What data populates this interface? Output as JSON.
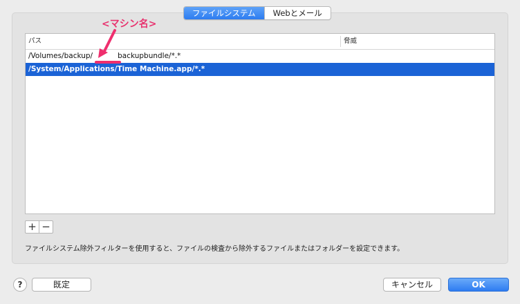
{
  "tabs": [
    {
      "label": "ファイルシステム",
      "selected": true
    },
    {
      "label": "Webとメール",
      "selected": false
    }
  ],
  "table": {
    "columns": {
      "path": "パス",
      "threat": "脅威"
    },
    "rows": [
      {
        "path_prefix": "/Volumes/backup/",
        "path_suffix": "backupbundle/*.*",
        "selected": false
      },
      {
        "path": "/System/Applications/Time Machine.app/*.*",
        "selected": true
      }
    ]
  },
  "buttons": {
    "add": "+",
    "remove": "−",
    "help": "?",
    "default": "既定",
    "cancel": "キャンセル",
    "ok": "OK"
  },
  "description": "ファイルシステム除外フィルターを使用すると、ファイルの検査から除外するファイルまたはフォルダーを設定できます。",
  "annotation": {
    "label": "<マシン名>",
    "color": "#e8336f"
  },
  "colors": {
    "accent": "#2c7cf0",
    "selection": "#1b63d6"
  }
}
